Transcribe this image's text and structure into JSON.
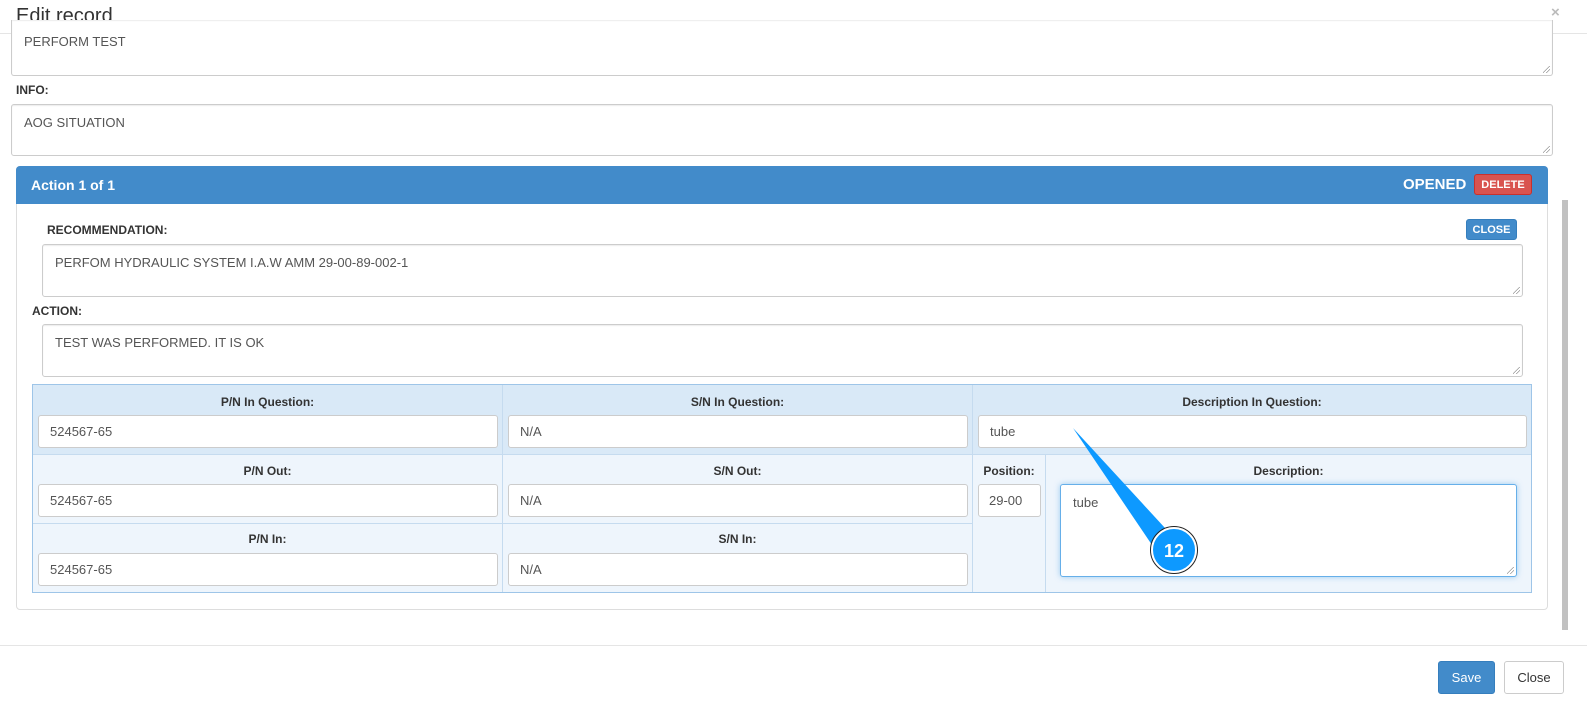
{
  "dialog": {
    "title": "Edit record",
    "close_icon": "×"
  },
  "fields": {
    "top_text": "PERFORM TEST",
    "info_label": "INFO:",
    "info_value": "AOG SITUATION"
  },
  "action": {
    "header": "Action 1 of 1",
    "status": "OPENED",
    "delete_label": "DELETE",
    "recommendation_label": "RECOMMENDATION:",
    "close_label": "CLOSE",
    "recommendation_value": "PERFOM HYDRAULIC SYSTEM I.A.W AMM 29-00-89-002-1",
    "action_label": "ACTION:",
    "action_value": "TEST WAS PERFORMED. IT IS OK"
  },
  "parts": {
    "pn_question_label": "P/N In Question:",
    "pn_question": "524567-65",
    "sn_question_label": "S/N In Question:",
    "sn_question": "N/A",
    "desc_question_label": "Description In Question:",
    "desc_question": "tube",
    "pn_out_label": "P/N Out:",
    "pn_out": "524567-65",
    "sn_out_label": "S/N Out:",
    "sn_out": "N/A",
    "position_label": "Position:",
    "position": "29-00",
    "description_label": "Description:",
    "description": "tube",
    "pn_in_label": "P/N In:",
    "pn_in": "524567-65",
    "sn_in_label": "S/N In:",
    "sn_in": "N/A"
  },
  "footer": {
    "save_label": "Save",
    "close_label": "Close"
  },
  "annotation": {
    "number": "12",
    "color": "#0d99ff"
  }
}
